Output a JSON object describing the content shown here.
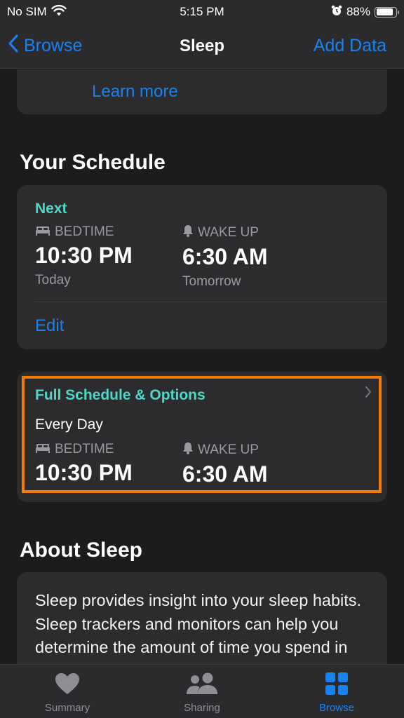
{
  "status_bar": {
    "carrier": "No SIM",
    "time": "5:15 PM",
    "battery_percent": "88%",
    "battery_level": 0.88,
    "icons": [
      "wifi-icon",
      "alarm-clock-icon",
      "battery-icon"
    ]
  },
  "nav": {
    "back_label": "Browse",
    "title": "Sleep",
    "action_label": "Add Data"
  },
  "learn_card": {
    "link_label": "Learn more"
  },
  "schedule": {
    "section_title": "Your Schedule",
    "next": {
      "heading": "Next",
      "bedtime_label": "BEDTIME",
      "bedtime_time": "10:30 PM",
      "bedtime_day": "Today",
      "wakeup_label": "WAKE UP",
      "wakeup_time": "6:30 AM",
      "wakeup_day": "Tomorrow",
      "edit_label": "Edit"
    },
    "full": {
      "heading": "Full Schedule & Options",
      "days": "Every Day",
      "bedtime_label": "BEDTIME",
      "bedtime_time": "10:30 PM",
      "wakeup_label": "WAKE UP",
      "wakeup_time": "6:30 AM"
    }
  },
  "about": {
    "section_title": "About Sleep",
    "text": "Sleep provides insight into your sleep habits. Sleep trackers and monitors can help you determine the amount of time you spend in bed and asleep. These"
  },
  "tabbar": {
    "tabs": [
      {
        "label": "Summary",
        "icon": "heart-icon",
        "active": false
      },
      {
        "label": "Sharing",
        "icon": "people-icon",
        "active": false
      },
      {
        "label": "Browse",
        "icon": "grid-icon",
        "active": true
      }
    ]
  },
  "colors": {
    "accent_blue": "#1a82f0",
    "teal": "#4dd8c8",
    "highlight_orange": "#f47b0a"
  }
}
